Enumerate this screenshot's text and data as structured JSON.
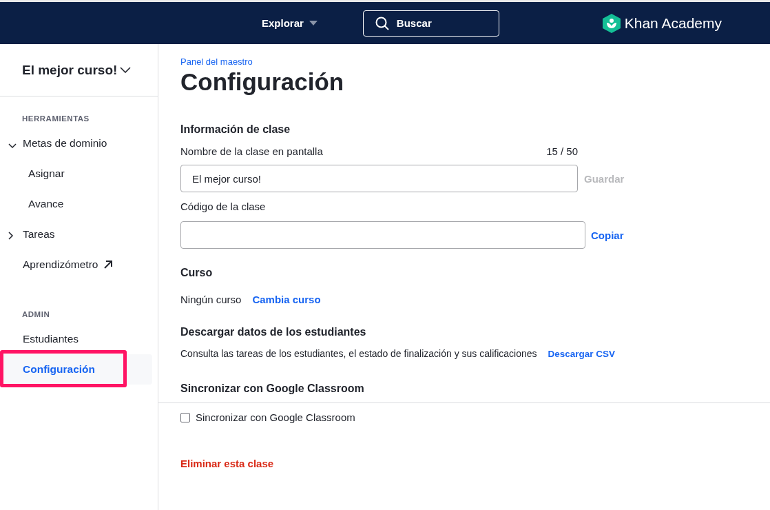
{
  "header": {
    "explore": "Explorar",
    "search": {
      "placeholder": "Buscar"
    },
    "logo": "Khan Academy"
  },
  "sidebar": {
    "course": "El mejor curso!",
    "sections": [
      {
        "title": "HERRAMIENTAS",
        "items": [
          {
            "label": "Metas de dominio",
            "kind": "group",
            "expanded": true,
            "selected": false,
            "children": [
              {
                "label": "Asignar",
                "selected": false
              },
              {
                "label": "Avance",
                "selected": false
              }
            ]
          },
          {
            "label": "Tareas",
            "kind": "group",
            "expanded": false,
            "selected": false
          },
          {
            "label": "Aprendizómetro",
            "kind": "external",
            "selected": false
          }
        ]
      },
      {
        "title": "ADMIN",
        "items": [
          {
            "label": "Estudiantes",
            "kind": "link",
            "selected": false
          },
          {
            "label": "Configuración",
            "kind": "link",
            "selected": true,
            "highlighted": true
          }
        ]
      }
    ]
  },
  "main": {
    "breadcrumb": "Panel del maestro",
    "title": "Configuración",
    "class_info": {
      "heading": "Información de clase",
      "name_label": "Nombre de la clase en pantalla",
      "counter": "15 / 50",
      "name_value": "El mejor curso!",
      "save": "Guardar",
      "save_disabled": true,
      "code_label": "Código de la clase",
      "copy": "Copiar"
    },
    "course": {
      "heading": "Curso",
      "value": "Ningún curso",
      "change": "Cambia curso"
    },
    "download": {
      "heading": "Descargar datos de los estudiantes",
      "description": "Consulta las tareas de los estudiantes, el estado de finalización y sus calificaciones",
      "link": "Descargar CSV"
    },
    "sync": {
      "heading": "Sincronizar con Google Classroom",
      "checkbox": {
        "label": "Sincronizar con Google Classroom",
        "checked": false
      }
    },
    "delete": "Eliminar esta clase"
  }
}
